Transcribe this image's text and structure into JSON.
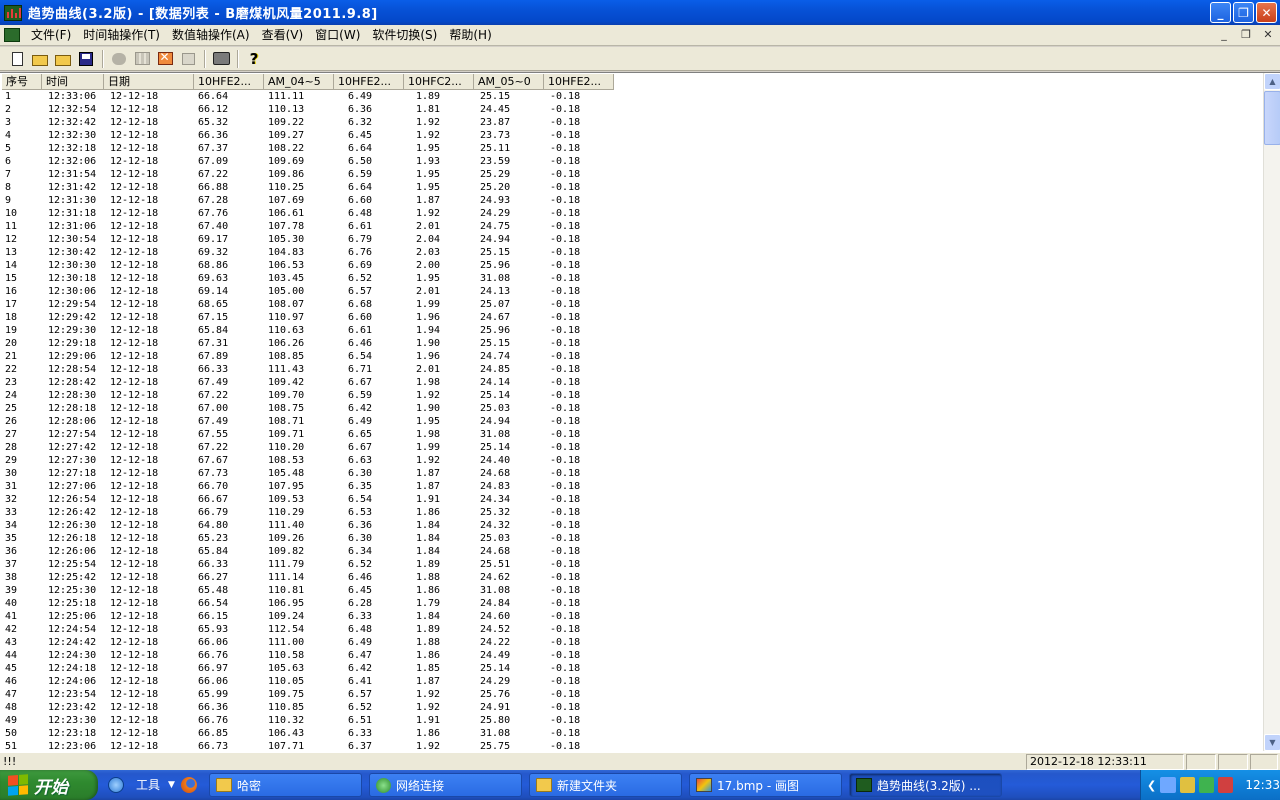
{
  "window": {
    "title": "趋势曲线(3.2版) - [数据列表 - B磨煤机风量2011.9.8]",
    "min_glyph": "_",
    "max_glyph": "❐",
    "close_glyph": "✕"
  },
  "menu": {
    "items": [
      "文件(F)",
      "时间轴操作(T)",
      "数值轴操作(A)",
      "查看(V)",
      "窗口(W)",
      "软件切换(S)",
      "帮助(H)"
    ],
    "mdi_min": "_",
    "mdi_restore": "❐",
    "mdi_close": "✕"
  },
  "toolbar": {
    "icons": [
      "new-file-icon",
      "open-folder-icon",
      "open-folder-alt-icon",
      "save-icon",
      "disabled-icon",
      "grid-icon",
      "image-icon",
      "window-icon",
      "print-icon",
      "help-icon"
    ],
    "help_glyph": "?"
  },
  "table": {
    "columns": [
      "序号",
      "时间",
      "日期",
      "10HFE2...",
      "AM_04~5",
      "10HFE2...",
      "10HFC2...",
      "AM_05~0",
      "10HFE2..."
    ],
    "rows": [
      [
        "1",
        "12:33:06",
        "12-12-18",
        "66.64",
        "111.11",
        "6.49",
        "1.89",
        "25.15",
        "-0.18"
      ],
      [
        "2",
        "12:32:54",
        "12-12-18",
        "66.12",
        "110.13",
        "6.36",
        "1.81",
        "24.45",
        "-0.18"
      ],
      [
        "3",
        "12:32:42",
        "12-12-18",
        "65.32",
        "109.22",
        "6.32",
        "1.92",
        "23.87",
        "-0.18"
      ],
      [
        "4",
        "12:32:30",
        "12-12-18",
        "66.36",
        "109.27",
        "6.45",
        "1.92",
        "23.73",
        "-0.18"
      ],
      [
        "5",
        "12:32:18",
        "12-12-18",
        "67.37",
        "108.22",
        "6.64",
        "1.95",
        "25.11",
        "-0.18"
      ],
      [
        "6",
        "12:32:06",
        "12-12-18",
        "67.09",
        "109.69",
        "6.50",
        "1.93",
        "23.59",
        "-0.18"
      ],
      [
        "7",
        "12:31:54",
        "12-12-18",
        "67.22",
        "109.86",
        "6.59",
        "1.95",
        "25.29",
        "-0.18"
      ],
      [
        "8",
        "12:31:42",
        "12-12-18",
        "66.88",
        "110.25",
        "6.64",
        "1.95",
        "25.20",
        "-0.18"
      ],
      [
        "9",
        "12:31:30",
        "12-12-18",
        "67.28",
        "107.69",
        "6.60",
        "1.87",
        "24.93",
        "-0.18"
      ],
      [
        "10",
        "12:31:18",
        "12-12-18",
        "67.76",
        "106.61",
        "6.48",
        "1.92",
        "24.29",
        "-0.18"
      ],
      [
        "11",
        "12:31:06",
        "12-12-18",
        "67.40",
        "107.78",
        "6.61",
        "2.01",
        "24.75",
        "-0.18"
      ],
      [
        "12",
        "12:30:54",
        "12-12-18",
        "69.17",
        "105.30",
        "6.79",
        "2.04",
        "24.94",
        "-0.18"
      ],
      [
        "13",
        "12:30:42",
        "12-12-18",
        "69.32",
        "104.83",
        "6.76",
        "2.03",
        "25.15",
        "-0.18"
      ],
      [
        "14",
        "12:30:30",
        "12-12-18",
        "68.86",
        "106.53",
        "6.69",
        "2.00",
        "25.96",
        "-0.18"
      ],
      [
        "15",
        "12:30:18",
        "12-12-18",
        "69.63",
        "103.45",
        "6.52",
        "1.95",
        "31.08",
        "-0.18"
      ],
      [
        "16",
        "12:30:06",
        "12-12-18",
        "69.14",
        "105.00",
        "6.57",
        "2.01",
        "24.13",
        "-0.18"
      ],
      [
        "17",
        "12:29:54",
        "12-12-18",
        "68.65",
        "108.07",
        "6.68",
        "1.99",
        "25.07",
        "-0.18"
      ],
      [
        "18",
        "12:29:42",
        "12-12-18",
        "67.15",
        "110.97",
        "6.60",
        "1.96",
        "24.67",
        "-0.18"
      ],
      [
        "19",
        "12:29:30",
        "12-12-18",
        "65.84",
        "110.63",
        "6.61",
        "1.94",
        "25.96",
        "-0.18"
      ],
      [
        "20",
        "12:29:18",
        "12-12-18",
        "67.31",
        "106.26",
        "6.46",
        "1.90",
        "25.15",
        "-0.18"
      ],
      [
        "21",
        "12:29:06",
        "12-12-18",
        "67.89",
        "108.85",
        "6.54",
        "1.96",
        "24.74",
        "-0.18"
      ],
      [
        "22",
        "12:28:54",
        "12-12-18",
        "66.33",
        "111.43",
        "6.71",
        "2.01",
        "24.85",
        "-0.18"
      ],
      [
        "23",
        "12:28:42",
        "12-12-18",
        "67.49",
        "109.42",
        "6.67",
        "1.98",
        "24.14",
        "-0.18"
      ],
      [
        "24",
        "12:28:30",
        "12-12-18",
        "67.22",
        "109.70",
        "6.59",
        "1.92",
        "25.14",
        "-0.18"
      ],
      [
        "25",
        "12:28:18",
        "12-12-18",
        "67.00",
        "108.75",
        "6.42",
        "1.90",
        "25.03",
        "-0.18"
      ],
      [
        "26",
        "12:28:06",
        "12-12-18",
        "67.49",
        "108.71",
        "6.49",
        "1.95",
        "24.94",
        "-0.18"
      ],
      [
        "27",
        "12:27:54",
        "12-12-18",
        "67.55",
        "109.71",
        "6.65",
        "1.98",
        "31.08",
        "-0.18"
      ],
      [
        "28",
        "12:27:42",
        "12-12-18",
        "67.22",
        "110.20",
        "6.67",
        "1.99",
        "25.14",
        "-0.18"
      ],
      [
        "29",
        "12:27:30",
        "12-12-18",
        "67.67",
        "108.53",
        "6.63",
        "1.92",
        "24.40",
        "-0.18"
      ],
      [
        "30",
        "12:27:18",
        "12-12-18",
        "67.73",
        "105.48",
        "6.30",
        "1.87",
        "24.68",
        "-0.18"
      ],
      [
        "31",
        "12:27:06",
        "12-12-18",
        "66.70",
        "107.95",
        "6.35",
        "1.87",
        "24.83",
        "-0.18"
      ],
      [
        "32",
        "12:26:54",
        "12-12-18",
        "66.67",
        "109.53",
        "6.54",
        "1.91",
        "24.34",
        "-0.18"
      ],
      [
        "33",
        "12:26:42",
        "12-12-18",
        "66.79",
        "110.29",
        "6.53",
        "1.86",
        "25.32",
        "-0.18"
      ],
      [
        "34",
        "12:26:30",
        "12-12-18",
        "64.80",
        "111.40",
        "6.36",
        "1.84",
        "24.32",
        "-0.18"
      ],
      [
        "35",
        "12:26:18",
        "12-12-18",
        "65.23",
        "109.26",
        "6.30",
        "1.84",
        "25.03",
        "-0.18"
      ],
      [
        "36",
        "12:26:06",
        "12-12-18",
        "65.84",
        "109.82",
        "6.34",
        "1.84",
        "24.68",
        "-0.18"
      ],
      [
        "37",
        "12:25:54",
        "12-12-18",
        "66.33",
        "111.79",
        "6.52",
        "1.89",
        "25.51",
        "-0.18"
      ],
      [
        "38",
        "12:25:42",
        "12-12-18",
        "66.27",
        "111.14",
        "6.46",
        "1.88",
        "24.62",
        "-0.18"
      ],
      [
        "39",
        "12:25:30",
        "12-12-18",
        "65.48",
        "110.81",
        "6.45",
        "1.86",
        "31.08",
        "-0.18"
      ],
      [
        "40",
        "12:25:18",
        "12-12-18",
        "66.54",
        "106.95",
        "6.28",
        "1.79",
        "24.84",
        "-0.18"
      ],
      [
        "41",
        "12:25:06",
        "12-12-18",
        "66.15",
        "109.24",
        "6.33",
        "1.84",
        "24.60",
        "-0.18"
      ],
      [
        "42",
        "12:24:54",
        "12-12-18",
        "65.93",
        "112.54",
        "6.48",
        "1.89",
        "24.52",
        "-0.18"
      ],
      [
        "43",
        "12:24:42",
        "12-12-18",
        "66.06",
        "111.00",
        "6.49",
        "1.88",
        "24.22",
        "-0.18"
      ],
      [
        "44",
        "12:24:30",
        "12-12-18",
        "66.76",
        "110.58",
        "6.47",
        "1.86",
        "24.49",
        "-0.18"
      ],
      [
        "45",
        "12:24:18",
        "12-12-18",
        "66.97",
        "105.63",
        "6.42",
        "1.85",
        "25.14",
        "-0.18"
      ],
      [
        "46",
        "12:24:06",
        "12-12-18",
        "66.06",
        "110.05",
        "6.41",
        "1.87",
        "24.29",
        "-0.18"
      ],
      [
        "47",
        "12:23:54",
        "12-12-18",
        "65.99",
        "109.75",
        "6.57",
        "1.92",
        "25.76",
        "-0.18"
      ],
      [
        "48",
        "12:23:42",
        "12-12-18",
        "66.36",
        "110.85",
        "6.52",
        "1.92",
        "24.91",
        "-0.18"
      ],
      [
        "49",
        "12:23:30",
        "12-12-18",
        "66.76",
        "110.32",
        "6.51",
        "1.91",
        "25.80",
        "-0.18"
      ],
      [
        "50",
        "12:23:18",
        "12-12-18",
        "66.85",
        "106.43",
        "6.33",
        "1.86",
        "31.08",
        "-0.18"
      ],
      [
        "51",
        "12:23:06",
        "12-12-18",
        "66.73",
        "107.71",
        "6.37",
        "1.92",
        "25.75",
        "-0.18"
      ]
    ]
  },
  "scrollbar": {
    "up_glyph": "▲",
    "down_glyph": "▼"
  },
  "statusbar": {
    "left": "!!!",
    "datetime": "2012-12-18   12:33:11"
  },
  "taskbar": {
    "start_label": "开始",
    "tools_label": "工具",
    "tasks": [
      "哈密",
      "网络连接",
      "新建文件夹",
      "17.bmp - 画图",
      "趋势曲线(3.2版) ..."
    ],
    "clock": "12:33"
  }
}
